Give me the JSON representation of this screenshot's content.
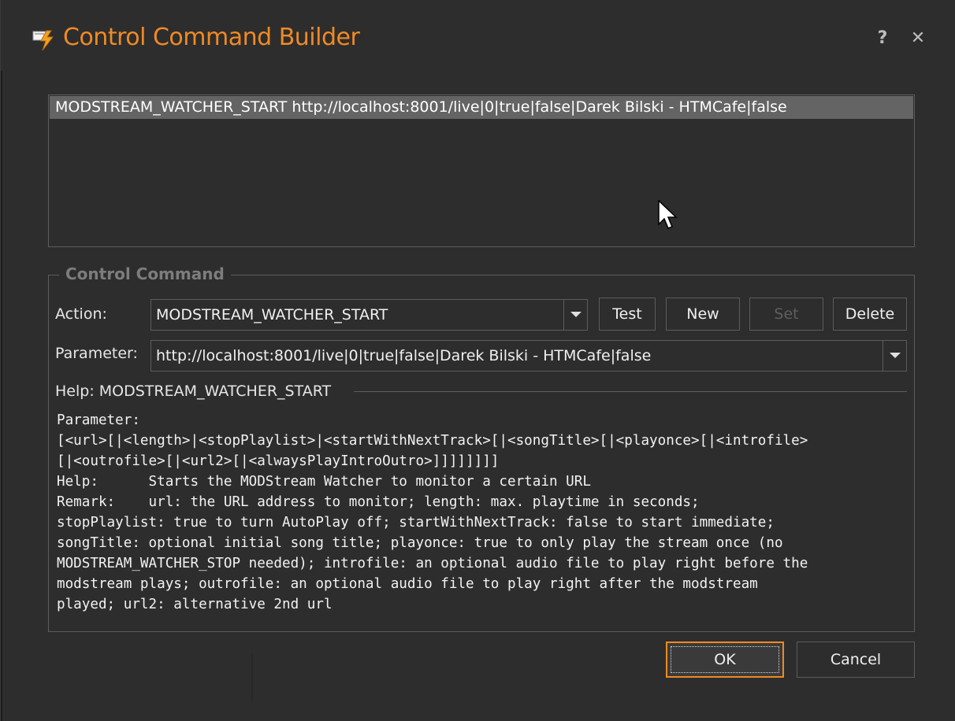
{
  "window": {
    "title": "Control Command Builder",
    "help_glyph": "?",
    "close_glyph": "✕"
  },
  "command_list": {
    "items": [
      "MODSTREAM_WATCHER_START http://localhost:8001/live|0|true|false|Darek Bilski - HTMCafe|false"
    ]
  },
  "group": {
    "title": "Control Command"
  },
  "action": {
    "label": "Action:",
    "value": "MODSTREAM_WATCHER_START"
  },
  "parameter": {
    "label": "Parameter:",
    "value": "http://localhost:8001/live|0|true|false|Darek Bilski - HTMCafe|false"
  },
  "buttons": {
    "test": "Test",
    "new": "New",
    "set": "Set",
    "delete": "Delete",
    "ok": "OK",
    "cancel": "Cancel"
  },
  "help": {
    "heading": "Help: MODSTREAM_WATCHER_START",
    "body": "Parameter:\n[<url>[|<length>|<stopPlaylist>|<startWithNextTrack>[|<songTitle>[|<playonce>[|<introfile>\n[|<outrofile>[|<url2>[|<alwaysPlayIntroOutro>]]]]]]]]\nHelp:      Starts the MODStream Watcher to monitor a certain URL\nRemark:    url: the URL address to monitor; length: max. playtime in seconds;\nstopPlaylist: true to turn AutoPlay off; startWithNextTrack: false to start immediate;\nsongTitle: optional initial song title; playonce: true to only play the stream once (no\nMODSTREAM_WATCHER_STOP needed); introfile: an optional audio file to play right before the\nmodstream plays; outrofile: an optional audio file to play right after the modstream\nplayed; url2: alternative 2nd url"
  },
  "colors": {
    "background": "#2d2d2d",
    "accent": "#f08a24",
    "selection": "#646464",
    "border": "#5c5c5c",
    "disabled_text": "#5e5e5e"
  }
}
